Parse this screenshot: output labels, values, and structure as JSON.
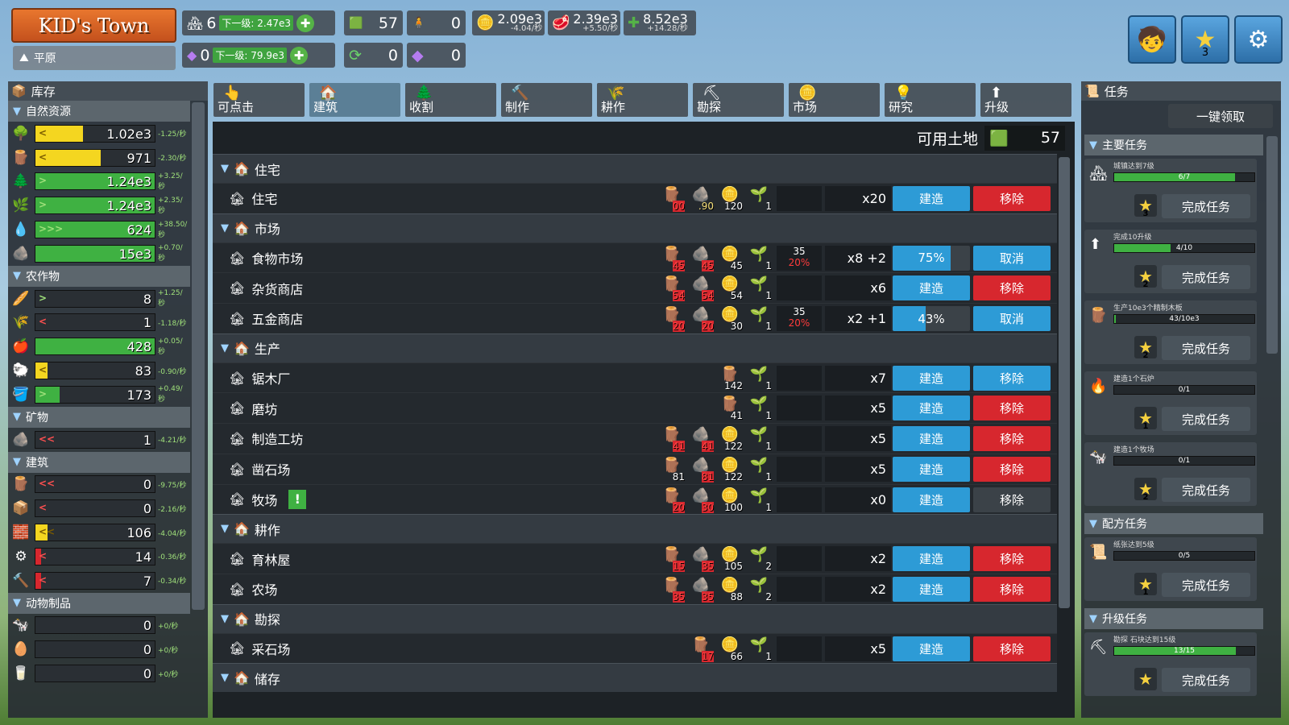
{
  "top": {
    "title": "KID's Town",
    "biome": "平原",
    "level": "6",
    "level_next": "下一级: 2.47e3",
    "gem": "0",
    "gem_next": "下一级: 79.9e3",
    "land": "57",
    "people": "0",
    "cycle": "0",
    "purple": "0",
    "coins": "2.09e3",
    "coins_rate": "-4.04/秒",
    "meat": "2.39e3",
    "meat_rate": "+5.50/秒",
    "green": "8.52e3",
    "green_rate": "+14.28/秒",
    "star_count": "3"
  },
  "inventory": {
    "title": "库存",
    "categories": [
      {
        "name": "自然资源",
        "rows": [
          {
            "icon": "🌳",
            "value": "1.02e3",
            "rate": "-1.25/秒",
            "fill": 0.4,
            "color": "#f4d620",
            "arrow": "<"
          },
          {
            "icon": "🪵",
            "value": "971",
            "rate": "-2.30/秒",
            "fill": 0.55,
            "color": "#f4d620",
            "arrow": "<"
          },
          {
            "icon": "🌲",
            "value": "1.24e3",
            "rate": "+3.25/秒",
            "fill": 1,
            "color": "#3fb142",
            "arrow": ">"
          },
          {
            "icon": "🌿",
            "value": "1.24e3",
            "rate": "+2.35/秒",
            "fill": 1,
            "color": "#3fb142",
            "arrow": ">"
          },
          {
            "icon": "💧",
            "value": "624",
            "rate": "+38.50/秒",
            "fill": 1,
            "color": "#3fb142",
            "arrow": ">>>"
          },
          {
            "icon": "🪨",
            "value": "15e3",
            "rate": "+0.70/秒",
            "fill": 1,
            "color": "#3fb142",
            "arrow": ""
          }
        ]
      },
      {
        "name": "农作物",
        "rows": [
          {
            "icon": "🥖",
            "value": "8",
            "rate": "+1.25/秒",
            "fill": 0,
            "color": "#3fb142",
            "arrow": ">"
          },
          {
            "icon": "🌾",
            "value": "1",
            "rate": "-1.18/秒",
            "fill": 0,
            "color": "#d7272e",
            "arrow": "<"
          },
          {
            "icon": "🍎",
            "value": "428",
            "rate": "+0.05/秒",
            "fill": 1,
            "color": "#3fb142",
            "arrow": ""
          },
          {
            "icon": "🐑",
            "value": "83",
            "rate": "-0.90/秒",
            "fill": 0.1,
            "color": "#f4d620",
            "arrow": "<"
          },
          {
            "icon": "🪣",
            "value": "173",
            "rate": "+0.49/秒",
            "fill": 0.2,
            "color": "#3fb142",
            "arrow": ">"
          }
        ]
      },
      {
        "name": "矿物",
        "rows": [
          {
            "icon": "🪨",
            "value": "1",
            "rate": "-4.21/秒",
            "fill": 0,
            "color": "#d7272e",
            "arrow": "<<"
          }
        ]
      },
      {
        "name": "建筑",
        "rows": [
          {
            "icon": "🪵",
            "value": "0",
            "rate": "-9.75/秒",
            "fill": 0,
            "color": "#d7272e",
            "arrow": "<<"
          },
          {
            "icon": "📦",
            "value": "0",
            "rate": "-2.16/秒",
            "fill": 0,
            "color": "#d7272e",
            "arrow": "<"
          },
          {
            "icon": "🧱",
            "value": "106",
            "rate": "-4.04/秒",
            "fill": 0.1,
            "color": "#f4d620",
            "arrow": "<<"
          },
          {
            "icon": "⚙",
            "value": "14",
            "rate": "-0.36/秒",
            "fill": 0.05,
            "color": "#d7272e",
            "arrow": "<"
          },
          {
            "icon": "🔨",
            "value": "7",
            "rate": "-0.34/秒",
            "fill": 0.05,
            "color": "#d7272e",
            "arrow": "<"
          }
        ]
      },
      {
        "name": "动物制品",
        "rows": [
          {
            "icon": "🐄",
            "value": "0",
            "rate": "+0/秒",
            "fill": 0,
            "color": "#3fb142",
            "arrow": ""
          },
          {
            "icon": "🥚",
            "value": "0",
            "rate": "+0/秒",
            "fill": 0,
            "color": "#3fb142",
            "arrow": ""
          },
          {
            "icon": "🥛",
            "value": "0",
            "rate": "+0/秒",
            "fill": 0,
            "color": "#3fb142",
            "arrow": ""
          }
        ]
      }
    ]
  },
  "tabs": [
    {
      "label": "可点击",
      "icon": "👆"
    },
    {
      "label": "建筑",
      "icon": "🏠"
    },
    {
      "label": "收割",
      "icon": "🌲"
    },
    {
      "label": "制作",
      "icon": "🔨"
    },
    {
      "label": "耕作",
      "icon": "🌾"
    },
    {
      "label": "勘探",
      "icon": "⛏"
    },
    {
      "label": "市场",
      "icon": "🪙"
    },
    {
      "label": "研究",
      "icon": "💡"
    },
    {
      "label": "升级",
      "icon": "⬆"
    }
  ],
  "available_land_label": "可用土地",
  "available_land": "57",
  "buildings": [
    {
      "group": "住宅",
      "items": [
        {
          "name": "住宅",
          "costs": [
            [
              "🪵",
              "00",
              "red"
            ],
            [
              "🪨",
              ".90",
              "yel"
            ],
            [
              "🪙",
              "120",
              ""
            ],
            [
              "🌱",
              "1",
              ""
            ]
          ],
          "extra": "",
          "count": "x20",
          "btn1": "建造",
          "btn2": "移除",
          "btn2color": "red"
        }
      ]
    },
    {
      "group": "市场",
      "items": [
        {
          "name": "食物市场",
          "costs": [
            [
              "🪵",
              "45",
              "red"
            ],
            [
              "🪨",
              "45",
              "red"
            ],
            [
              "🪙",
              "45",
              ""
            ],
            [
              "🌱",
              "1",
              ""
            ]
          ],
          "extra": "35",
          "extra2": "20%",
          "count": "x8 +2",
          "btn1": "75%",
          "prog": 0.75,
          "btn2": "取消",
          "btn2color": "blue"
        },
        {
          "name": "杂货商店",
          "costs": [
            [
              "🪵",
              "54",
              "red"
            ],
            [
              "🪨",
              "54",
              "red"
            ],
            [
              "🪙",
              "54",
              ""
            ],
            [
              "🌱",
              "1",
              ""
            ]
          ],
          "extra": "",
          "count": "x6",
          "btn1": "建造",
          "btn2": "移除",
          "btn2color": "red"
        },
        {
          "name": "五金商店",
          "costs": [
            [
              "🪵",
              "20",
              "red"
            ],
            [
              "🪨",
              "20",
              "red"
            ],
            [
              "🪙",
              "30",
              ""
            ],
            [
              "🌱",
              "1",
              ""
            ]
          ],
          "extra": "35",
          "extra2": "20%",
          "count": "x2 +1",
          "btn1": "43%",
          "prog": 0.43,
          "btn2": "取消",
          "btn2color": "blue"
        }
      ]
    },
    {
      "group": "生产",
      "items": [
        {
          "name": "锯木厂",
          "costs": [
            [
              "🪵",
              "142",
              ""
            ],
            [
              "🌱",
              "1",
              ""
            ]
          ],
          "extra": "",
          "count": "x7",
          "btn1": "建造",
          "btn2": "移除",
          "btn2color": "blue"
        },
        {
          "name": "磨坊",
          "costs": [
            [
              "🪵",
              "41",
              ""
            ],
            [
              "🌱",
              "1",
              ""
            ]
          ],
          "extra": "",
          "count": "x5",
          "btn1": "建造",
          "btn2": "移除",
          "btn2color": "red"
        },
        {
          "name": "制造工坊",
          "costs": [
            [
              "🪵",
              "41",
              "red"
            ],
            [
              "🪨",
              "41",
              "red"
            ],
            [
              "🪙",
              "122",
              ""
            ],
            [
              "🌱",
              "1",
              ""
            ]
          ],
          "extra": "",
          "count": "x5",
          "btn1": "建造",
          "btn2": "移除",
          "btn2color": "red"
        },
        {
          "name": "凿石场",
          "costs": [
            [
              "🪵",
              "81",
              ""
            ],
            [
              "🪨",
              "81",
              "red"
            ],
            [
              "🪙",
              "122",
              ""
            ],
            [
              "🌱",
              "1",
              ""
            ]
          ],
          "extra": "",
          "count": "x5",
          "btn1": "建造",
          "btn2": "移除",
          "btn2color": "red"
        },
        {
          "name": "牧场",
          "costs": [
            [
              "🪵",
              "20",
              "red"
            ],
            [
              "🪨",
              "30",
              "red"
            ],
            [
              "🪙",
              "100",
              ""
            ],
            [
              "🌱",
              "1",
              ""
            ]
          ],
          "extra": "",
          "count": "x0",
          "btn1": "建造",
          "btn2": "移除",
          "btn2color": "grey",
          "alert": "!"
        }
      ]
    },
    {
      "group": "耕作",
      "items": [
        {
          "name": "育林屋",
          "costs": [
            [
              "🪵",
              "15",
              "red"
            ],
            [
              "🪨",
              "35",
              "red"
            ],
            [
              "🪙",
              "105",
              ""
            ],
            [
              "🌱",
              "2",
              ""
            ]
          ],
          "extra": "",
          "count": "x2",
          "btn1": "建造",
          "btn2": "移除",
          "btn2color": "red"
        },
        {
          "name": "农场",
          "costs": [
            [
              "🪵",
              "35",
              "red"
            ],
            [
              "🪨",
              "35",
              "red"
            ],
            [
              "🪙",
              "88",
              ""
            ],
            [
              "🌱",
              "2",
              ""
            ]
          ],
          "extra": "",
          "count": "x2",
          "btn1": "建造",
          "btn2": "移除",
          "btn2color": "red"
        }
      ]
    },
    {
      "group": "勘探",
      "items": [
        {
          "name": "采石场",
          "costs": [
            [
              "🪵",
              "17",
              "red"
            ],
            [
              "🪙",
              "66",
              ""
            ],
            [
              "🌱",
              "1",
              ""
            ]
          ],
          "extra": "",
          "count": "x5",
          "btn1": "建造",
          "btn2": "移除",
          "btn2color": "red"
        }
      ]
    },
    {
      "group": "储存",
      "items": []
    }
  ],
  "tasks": {
    "title": "任务",
    "claim_all": "一键领取",
    "sections": [
      {
        "name": "主要任务",
        "quests": [
          {
            "icon": "🏘",
            "title": "城镇达到7级",
            "progress": "6/7",
            "fill": 0.86,
            "reward": "3",
            "btn": "完成任务"
          },
          {
            "icon": "⬆",
            "title": "完成10升级",
            "progress": "4/10",
            "fill": 0.4,
            "reward": "2",
            "btn": "完成任务"
          },
          {
            "icon": "🪵",
            "title": "生产10e3个精制木板",
            "progress": "43/10e3",
            "fill": 0.01,
            "reward": "2",
            "btn": "完成任务"
          },
          {
            "icon": "🔥",
            "title": "建造1个石炉",
            "progress": "0/1",
            "fill": 0,
            "reward": "1",
            "btn": "完成任务"
          },
          {
            "icon": "🐄",
            "title": "建造1个牧场",
            "progress": "0/1",
            "fill": 0,
            "reward": "2",
            "btn": "完成任务"
          }
        ]
      },
      {
        "name": "配方任务",
        "quests": [
          {
            "icon": "📜",
            "title": "纸张达到5级",
            "progress": "0/5",
            "fill": 0,
            "reward": "1",
            "btn": "完成任务"
          }
        ]
      },
      {
        "name": "升级任务",
        "quests": [
          {
            "icon": "⛏",
            "title": "勘探 石块达到15级",
            "progress": "13/15",
            "fill": 0.87,
            "reward": "",
            "btn": "完成任务"
          }
        ]
      }
    ]
  }
}
